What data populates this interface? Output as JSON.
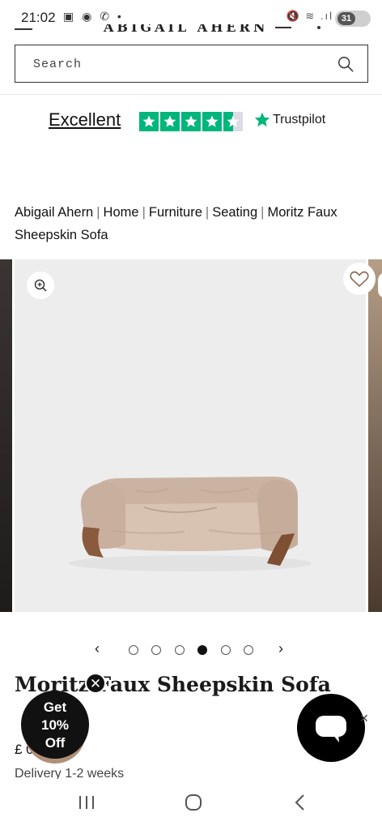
{
  "status_bar": {
    "time": "21:02",
    "left_icons": "▣ ◉ ✆ •",
    "right_icons": "🔇 ≋ .ıl",
    "battery": "31"
  },
  "header": {
    "logo": "ABIGAIL AHERN"
  },
  "search": {
    "placeholder": "Search"
  },
  "trustpilot": {
    "rating_label": "Excellent",
    "brand": "Trustpilot",
    "stars": 4.5,
    "color": "#00b67a"
  },
  "breadcrumb": {
    "items": [
      "Abigail Ahern",
      "Home",
      "Furniture",
      "Seating",
      "Moritz Faux Sheepskin Sofa"
    ],
    "separator": "|"
  },
  "gallery": {
    "total_slides": 6,
    "active_index": 3,
    "prev_label": "‹",
    "next_label": "›"
  },
  "product": {
    "title": "Moritz Faux Sheepskin Sofa",
    "price_visible": "£          0",
    "delivery": "Delivery 1-2 weeks"
  },
  "promo": {
    "line1": "Get",
    "line2": "10%",
    "line3": "Off",
    "close_label": "✕"
  },
  "chat": {
    "dismiss_label": "✕"
  }
}
